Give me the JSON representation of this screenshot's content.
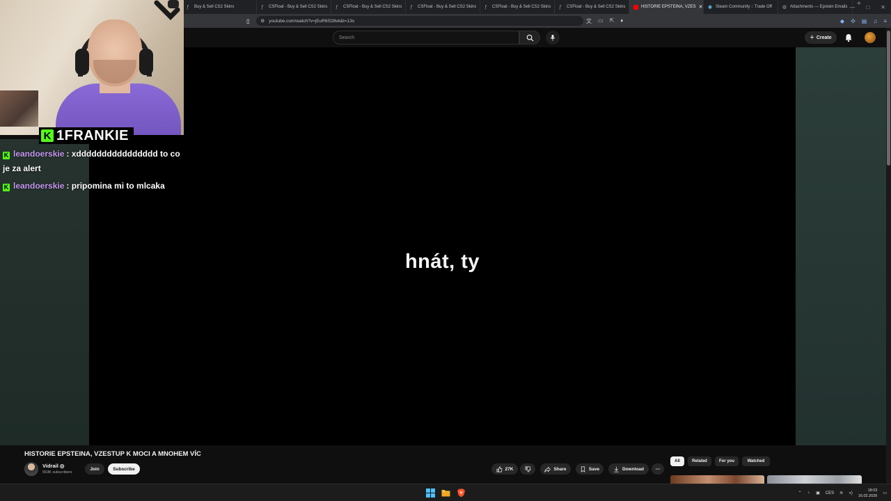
{
  "browser": {
    "tabs": [
      {
        "label": "Buy & Sell CS2 Skins",
        "icon": "csfloat-icon"
      },
      {
        "label": "CSFloat - Buy & Sell CS2 Skins",
        "icon": "csfloat-icon"
      },
      {
        "label": "CSFloat - Buy & Sell CS2 Skins",
        "icon": "csfloat-icon"
      },
      {
        "label": "CSFloat - Buy & Sell CS2 Skins",
        "icon": "csfloat-icon"
      },
      {
        "label": "CSFloat - Buy & Sell CS2 Skins",
        "icon": "csfloat-icon"
      },
      {
        "label": "CSFloat - Buy & Sell CS2 Skins",
        "icon": "csfloat-icon"
      },
      {
        "label": "HISTORIE EPSTEINA, VZES",
        "icon": "youtube-icon",
        "active": true
      },
      {
        "label": "Steam Community :: Trade Off",
        "icon": "steam-icon"
      },
      {
        "label": "Attachments — Epstein Emails",
        "icon": "globe-icon"
      }
    ],
    "url": "youtube.com/watch?v=jEuR6S28vk&t=13s"
  },
  "youtube": {
    "search_placeholder": "Search",
    "create_label": "Create"
  },
  "video": {
    "subtitle": "hnát, ty",
    "title": "HISTORIE EPSTEINA, VZESTUP K MOCI A MNOHEM VÍC",
    "channel_name": "Vidrail ◎",
    "subscribers": "553K subscribers",
    "join_label": "Join",
    "subscribe_label": "Subscribe",
    "likes": "27K",
    "share_label": "Share",
    "save_label": "Save",
    "download_label": "Download"
  },
  "filter_chips": [
    "All",
    "Related",
    "For you",
    "Watched"
  ],
  "stream": {
    "streamer_badge": "K",
    "streamer_name": "1FRANKIE",
    "chat": [
      {
        "badge": "K",
        "user": "leandoerskie",
        "message": ": xdddddddddddddddd to co je za alert"
      },
      {
        "badge": "K",
        "user": "leandoerskie",
        "message": ": pripomina mi to mlcaka"
      }
    ]
  },
  "taskbar": {
    "lang": "CES",
    "time": "18:03",
    "date": "16.02.2026"
  },
  "colors": {
    "kick_green": "#53fc18",
    "chat_username": "#c59cf0",
    "youtube_red": "#ff0000"
  }
}
